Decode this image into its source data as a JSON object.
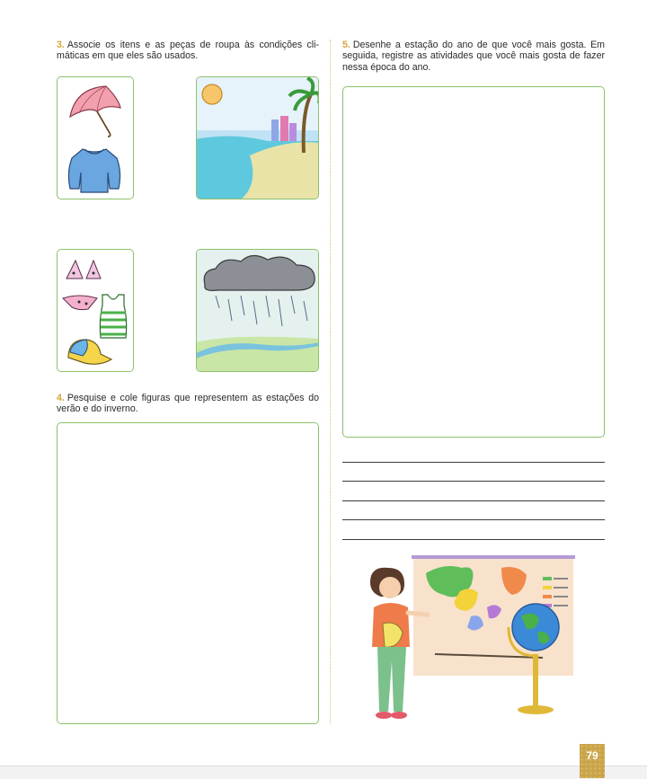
{
  "q3": {
    "number": "3.",
    "text": "Associe os itens e as peças de roupa às condições cli­máticas em que eles são usados."
  },
  "q4": {
    "number": "4.",
    "text": "Pesquise e cole figuras que representem as estações do verão e do inverno."
  },
  "q5": {
    "number": "5.",
    "text": "Desenhe a estação do ano de que você mais gosta. Em seguida, registre as atividades que você mais gosta de fazer nessa época do ano."
  },
  "page_number": "79",
  "icons": {
    "umbrella": "umbrella-icon",
    "sweater": "sweater-icon",
    "bikini": "bikini-icon",
    "tank_top": "tank-top-icon",
    "cap": "cap-icon",
    "beach": "beach-illustration",
    "rain": "rain-illustration",
    "teacher": "teacher-illustration",
    "map": "map-illustration",
    "globe": "globe-icon"
  },
  "colors": {
    "accent": "#d4a53a",
    "frame": "#8cc06a",
    "page_badge": "#c9a44a"
  }
}
